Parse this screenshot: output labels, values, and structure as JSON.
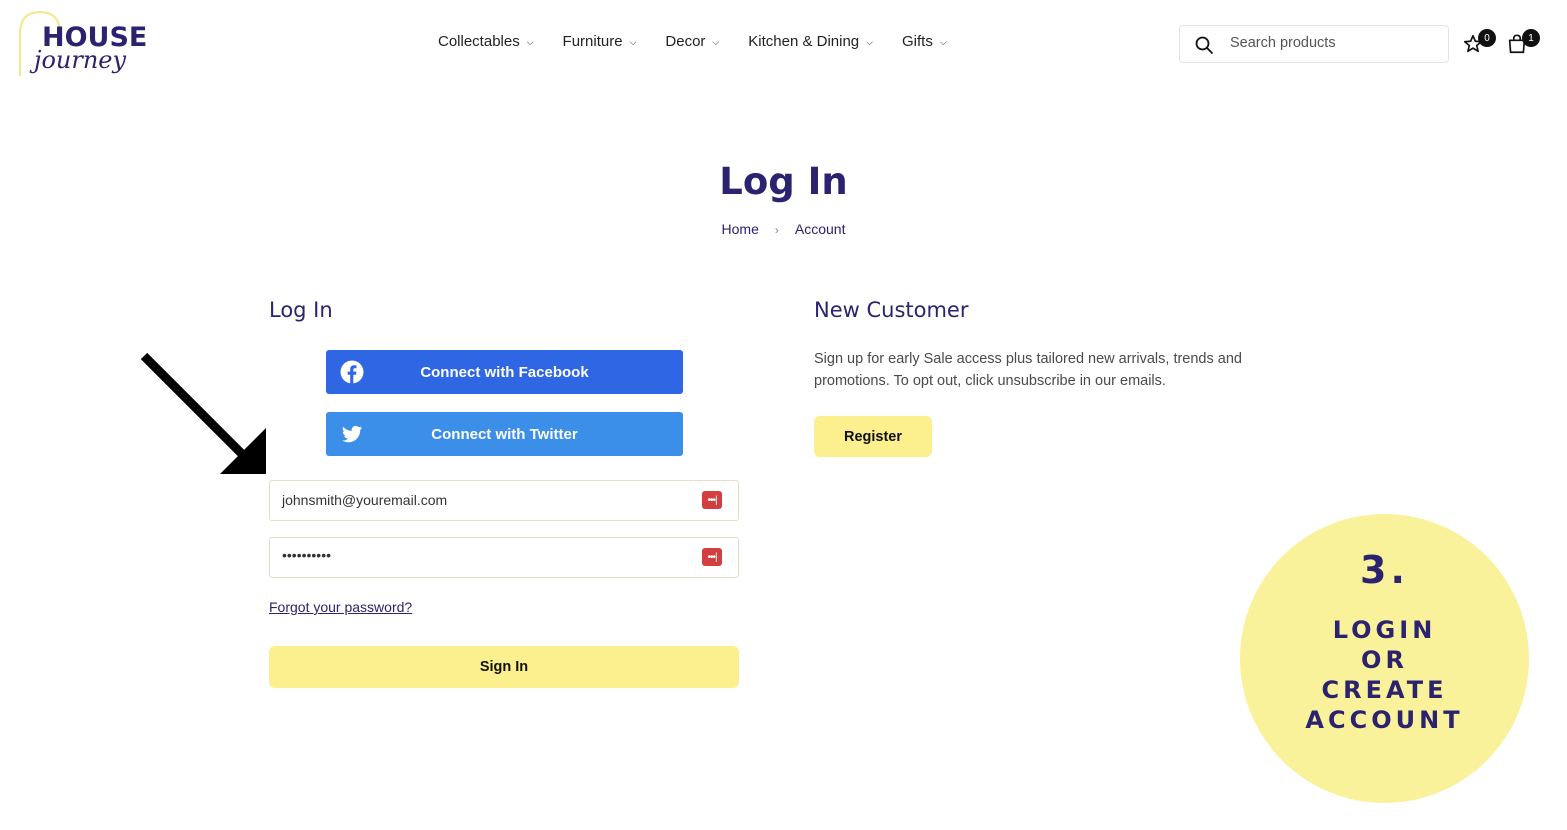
{
  "brand": {
    "logo_line1": "HOUSE",
    "logo_line2": "journey"
  },
  "nav": [
    {
      "label": "Collectables"
    },
    {
      "label": "Furniture"
    },
    {
      "label": "Decor"
    },
    {
      "label": "Kitchen & Dining"
    },
    {
      "label": "Gifts"
    }
  ],
  "search": {
    "placeholder": "Search products"
  },
  "wishlist": {
    "count": "0"
  },
  "cart": {
    "count": "1"
  },
  "page": {
    "title": "Log In"
  },
  "breadcrumb": {
    "home": "Home",
    "separator": "›",
    "current": "Account"
  },
  "login": {
    "heading": "Log In",
    "facebook_label": "Connect with Facebook",
    "twitter_label": "Connect with Twitter",
    "email_value": "johnsmith@youremail.com",
    "password_value": "••••••••••",
    "forgot_label": "Forgot your password?",
    "signin_label": "Sign In"
  },
  "new_customer": {
    "heading": "New Customer",
    "description": "Sign up for early Sale access plus tailored new arrivals, trends and promotions. To opt out, click unsubscribe in our emails.",
    "register_label": "Register"
  },
  "annotation": {
    "step": "3.",
    "line1": "LOGIN",
    "line2": "OR",
    "line3": "CREATE",
    "line4": "ACCOUNT"
  },
  "colors": {
    "brand_navy": "#2b2370",
    "accent_yellow": "#fbf08d",
    "facebook": "#2f66e3",
    "twitter": "#3b8fe8"
  }
}
